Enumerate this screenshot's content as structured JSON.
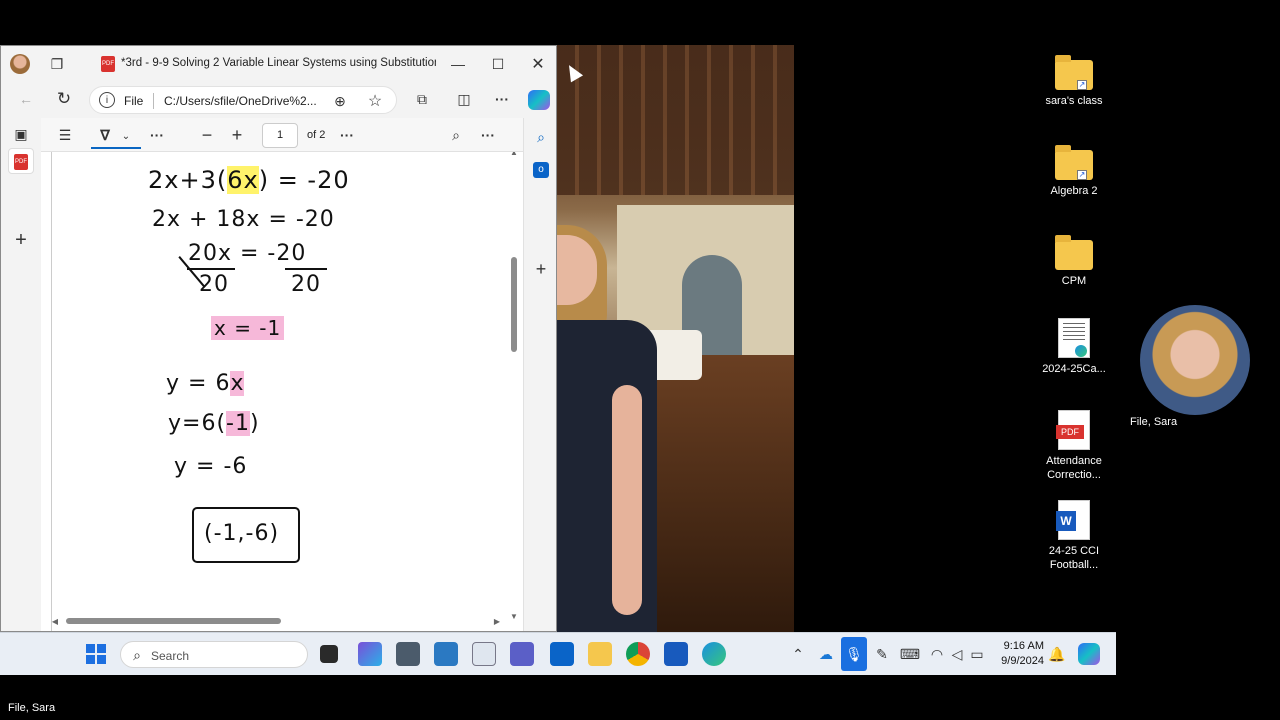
{
  "window": {
    "tab_title": "*3rd - 9-9 Solving 2 Variable Linear Systems using Substitution N...",
    "file_label": "File",
    "url": "C:/Users/sfile/OneDrive%2..."
  },
  "pdf_toolbar": {
    "page_number": "1",
    "page_total": "of 2"
  },
  "handwriting": {
    "line1_a": "2x+3(",
    "line1_hl": "6x",
    "line1_b": ") = -20",
    "line2": "2x + 18x  = -20",
    "line3_num": "20x = -20",
    "line3_den_left": "20",
    "line3_den_right": "20",
    "x_solution": "x = -1",
    "y_line1_a": "y = 6",
    "y_line1_hl": "x",
    "y_line2_a": "y=6(",
    "y_line2_hl": "-1",
    "y_line2_b": ")",
    "y_line3": "y = -6",
    "answer": "(-1,-6)"
  },
  "desktop": {
    "icons": [
      {
        "label": "sara's class",
        "type": "folder"
      },
      {
        "label": "Algebra 2",
        "type": "folder"
      },
      {
        "label": "CPM",
        "type": "folder"
      },
      {
        "label": "2024-25Ca...",
        "type": "document"
      },
      {
        "label": "Attendance Correctio...",
        "type": "pdf"
      },
      {
        "label": "24-25 CCI Football...",
        "type": "word"
      }
    ],
    "webcam_name": "File, Sara"
  },
  "taskbar": {
    "search_placeholder": "Search",
    "time": "9:16 AM",
    "date": "9/9/2024"
  },
  "meeting": {
    "participant_name": "File, Sara"
  },
  "colors": {
    "highlight_yellow": "#fff36b",
    "highlight_pink": "#f6b8d9",
    "edge_accent": "#0a66c2"
  }
}
